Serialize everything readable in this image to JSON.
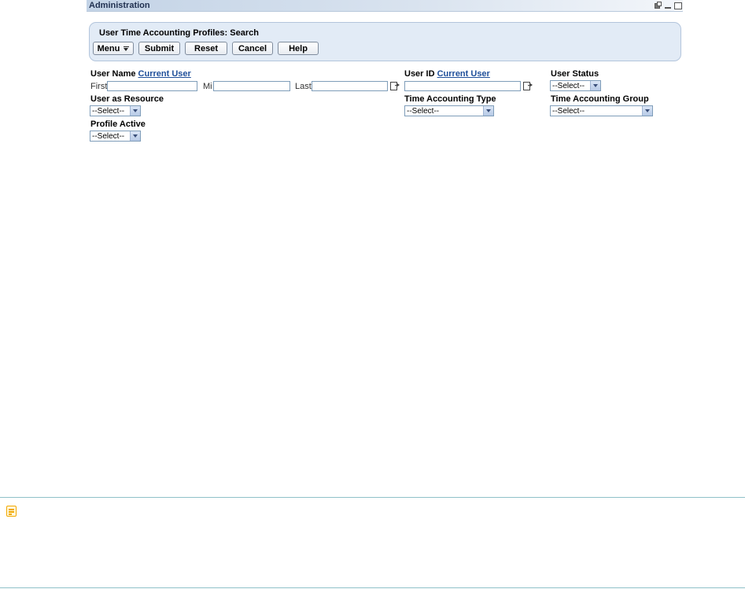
{
  "portlet": {
    "title": "Administration"
  },
  "panel": {
    "title": "User Time Accounting Profiles: Search",
    "buttons": {
      "menu": "Menu",
      "submit": "Submit",
      "reset": "Reset",
      "cancel": "Cancel",
      "help": "Help"
    }
  },
  "form": {
    "user_name": {
      "label": "User Name",
      "link": "Current User",
      "first": "First",
      "mi": "Mi",
      "last": "Last"
    },
    "user_id": {
      "label": "User ID",
      "link": "Current User"
    },
    "user_status": {
      "label": "User Status",
      "value": "--Select--"
    },
    "user_as_resource": {
      "label": "User as Resource",
      "value": "--Select--"
    },
    "time_accounting_type": {
      "label": "Time Accounting Type",
      "value": "--Select--"
    },
    "time_accounting_group": {
      "label": "Time Accounting Group",
      "value": "--Select--"
    },
    "profile_active": {
      "label": "Profile Active",
      "value": "--Select--"
    }
  },
  "icons": {
    "restore": "restore-icon",
    "minimize": "minimize-icon",
    "maximize": "maximize-icon",
    "lookup": "lookup-icon",
    "note": "note-icon"
  },
  "colors": {
    "note_accent": "#f1a800",
    "divider": "#8fc1c9",
    "link": "#1f4f9a",
    "panel_bg": "#e2ebf6"
  }
}
